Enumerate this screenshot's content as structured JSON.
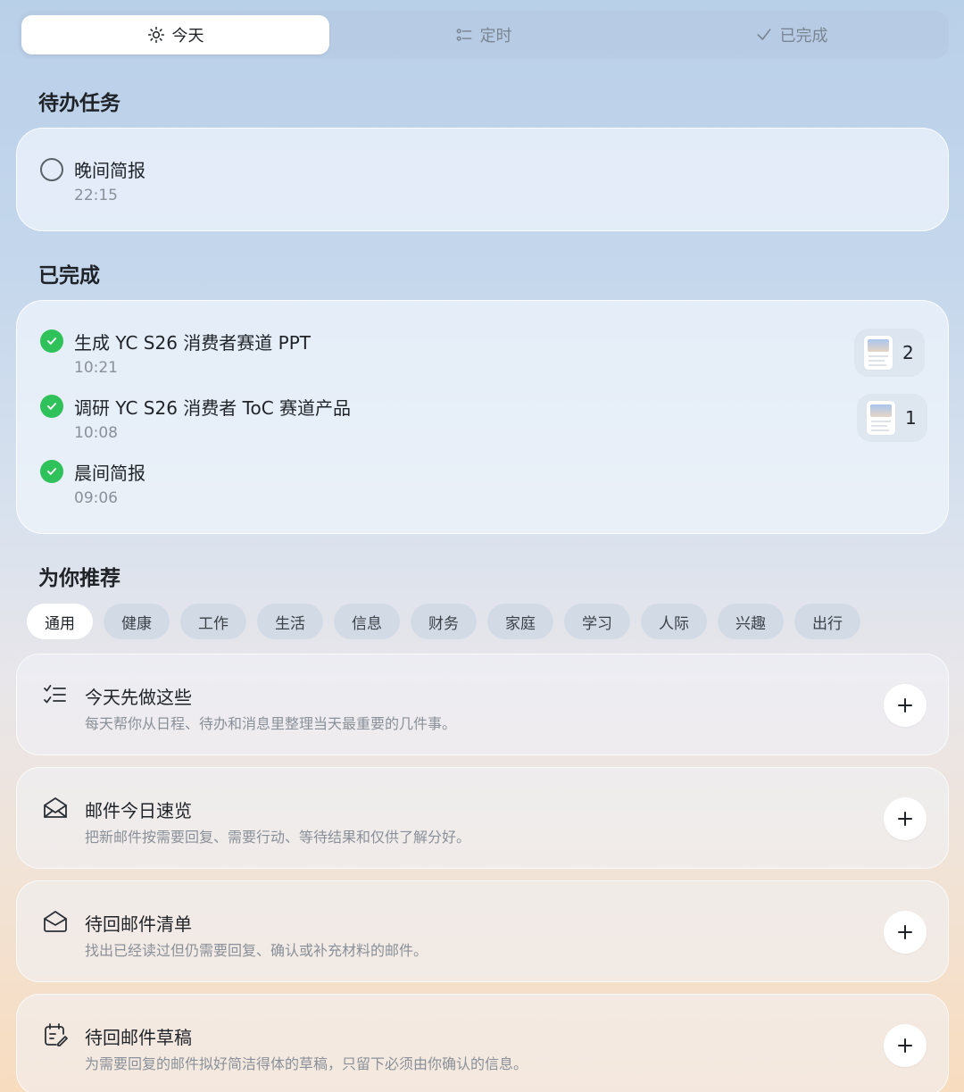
{
  "tabs": [
    {
      "label": "今天",
      "icon": "sun-icon",
      "active": true
    },
    {
      "label": "定时",
      "icon": "schedule-list-icon",
      "active": false
    },
    {
      "label": "已完成",
      "icon": "check-icon",
      "active": false
    }
  ],
  "todo": {
    "title": "待办任务",
    "items": [
      {
        "title": "晚间简报",
        "time": "22:15"
      }
    ]
  },
  "done": {
    "title": "已完成",
    "items": [
      {
        "title": "生成 YC S26 消费者赛道 PPT",
        "time": "10:21",
        "attachment_count": "2"
      },
      {
        "title": "调研 YC S26 消费者 ToC 赛道产品",
        "time": "10:08",
        "attachment_count": "1"
      },
      {
        "title": "晨间简报",
        "time": "09:06"
      }
    ]
  },
  "recommend": {
    "title": "为你推荐",
    "chips": [
      "通用",
      "健康",
      "工作",
      "生活",
      "信息",
      "财务",
      "家庭",
      "学习",
      "人际",
      "兴趣",
      "出行"
    ],
    "active_chip": "通用",
    "items": [
      {
        "title": "今天先做这些",
        "desc": "每天帮你从日程、待办和消息里整理当天最重要的几件事。",
        "icon": "checklist-icon"
      },
      {
        "title": "邮件今日速览",
        "desc": "把新邮件按需要回复、需要行动、等待结果和仅供了解分好。",
        "icon": "mail-open-icon"
      },
      {
        "title": "待回邮件清单",
        "desc": "找出已经读过但仍需要回复、确认或补充材料的邮件。",
        "icon": "mail-envelope-icon"
      },
      {
        "title": "待回邮件草稿",
        "desc": "为需要回复的邮件拟好简洁得体的草稿，只留下必须由你确认的信息。",
        "icon": "calendar-edit-icon"
      }
    ]
  },
  "colors": {
    "accent_green": "#2fc25b",
    "text_primary": "#1f2328",
    "text_secondary": "#8a9099"
  }
}
